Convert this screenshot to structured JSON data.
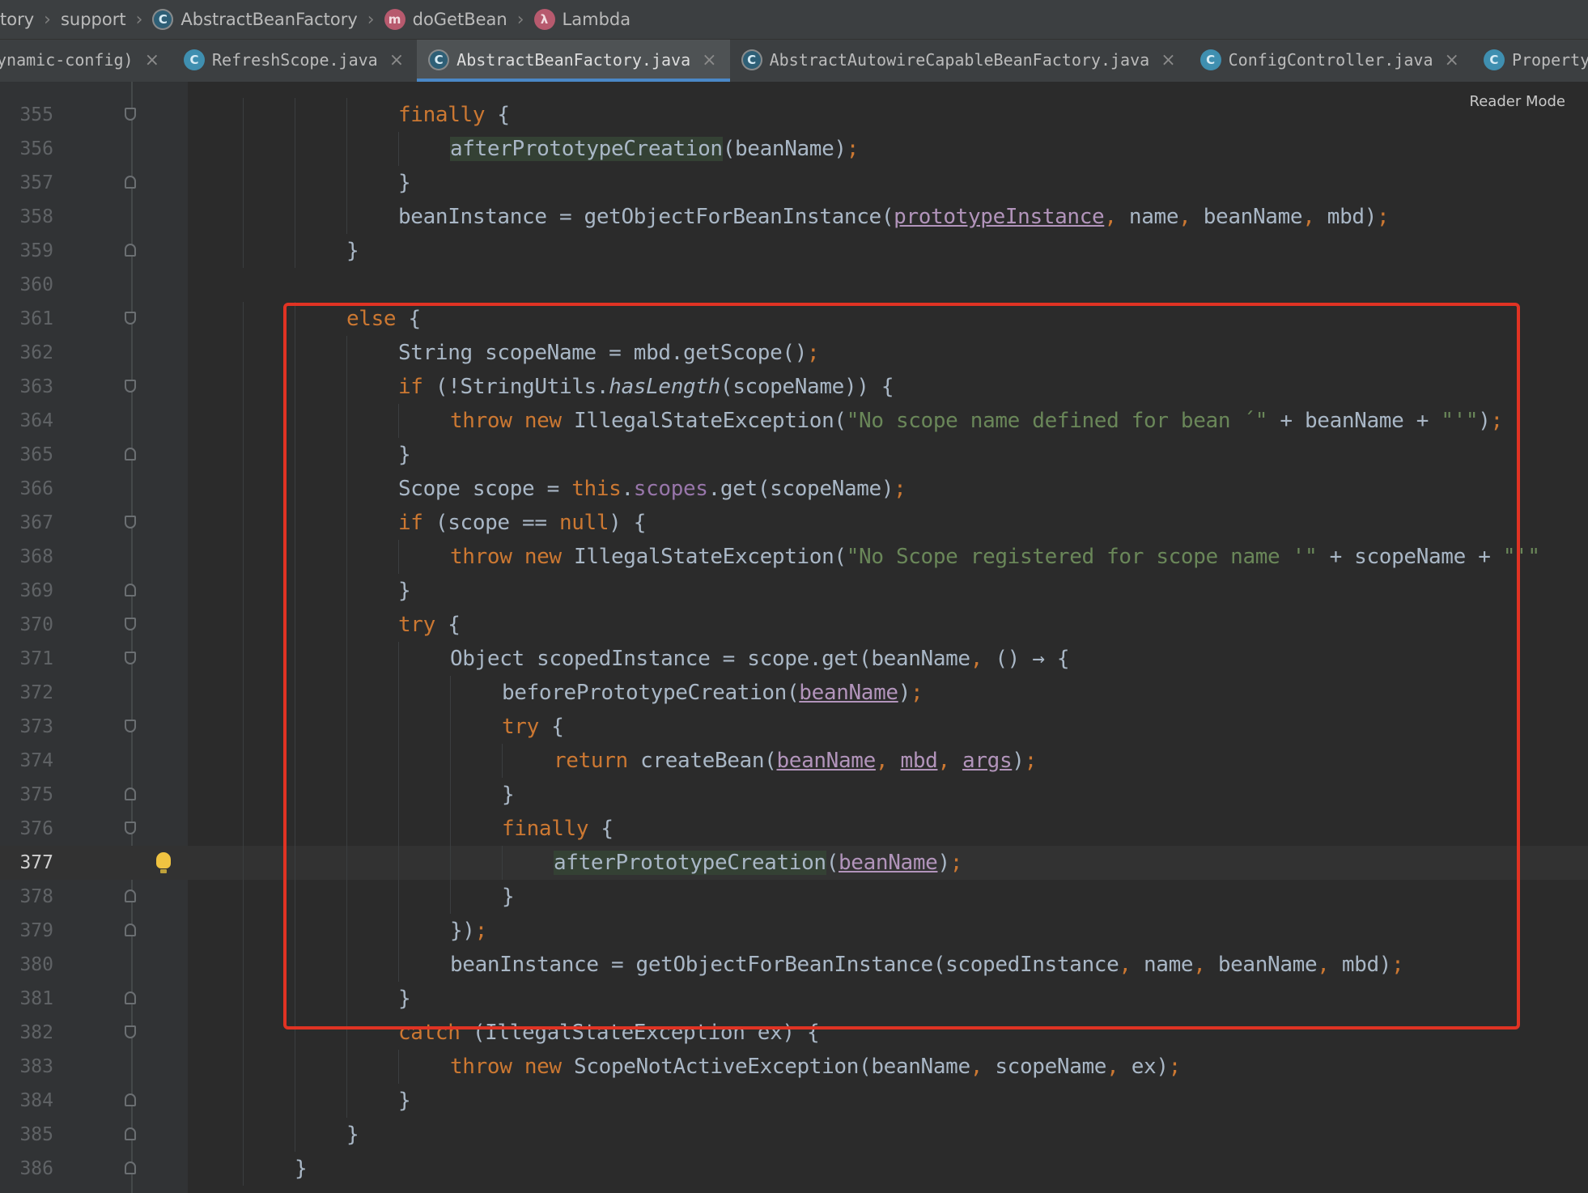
{
  "breadcrumb": {
    "items": [
      "tory",
      "support",
      "AbstractBeanFactory",
      "doGetBean",
      "Lambda"
    ]
  },
  "tabs": [
    {
      "label": "ynamic-config)",
      "active": false,
      "icon": "none"
    },
    {
      "label": "RefreshScope.java",
      "active": false,
      "icon": "class-icon"
    },
    {
      "label": "AbstractBeanFactory.java",
      "active": true,
      "icon": "abstract-class-icon"
    },
    {
      "label": "AbstractAutowireCapableBeanFactory.java",
      "active": false,
      "icon": "abstract-class-icon"
    },
    {
      "label": "ConfigController.java",
      "active": false,
      "icon": "class-icon"
    },
    {
      "label": "PropertySetting.j",
      "active": false,
      "icon": "class-icon"
    }
  ],
  "editor": {
    "reader_mode": "Reader Mode",
    "current_line": 377,
    "lines": [
      {
        "n": "355",
        "fold": "open",
        "indent": 4,
        "parts": [
          [
            "kw",
            "finally"
          ],
          [
            "p",
            " {"
          ]
        ]
      },
      {
        "n": "356",
        "fold": "",
        "indent": 5,
        "parts": [
          [
            "hl",
            "afterPrototypeCreation"
          ],
          [
            "p",
            "(beanName)"
          ],
          [
            "punc",
            ";"
          ]
        ]
      },
      {
        "n": "357",
        "fold": "close",
        "indent": 4,
        "parts": [
          [
            "p",
            "}"
          ]
        ]
      },
      {
        "n": "358",
        "fold": "",
        "indent": 4,
        "parts": [
          [
            "p",
            "beanInstance = getObjectForBeanInstance("
          ],
          [
            "und0",
            "prototypeInstance"
          ],
          [
            "punc",
            ", "
          ],
          [
            "p",
            "name"
          ],
          [
            "punc",
            ", "
          ],
          [
            "p",
            "beanName"
          ],
          [
            "punc",
            ", "
          ],
          [
            "p",
            "mbd)"
          ],
          [
            "punc",
            ";"
          ]
        ]
      },
      {
        "n": "359",
        "fold": "close",
        "indent": 3,
        "parts": [
          [
            "p",
            "}"
          ]
        ]
      },
      {
        "n": "360",
        "fold": "",
        "indent": 0,
        "parts": []
      },
      {
        "n": "361",
        "fold": "open",
        "indent": 3,
        "parts": [
          [
            "kw",
            "else"
          ],
          [
            "p",
            " {"
          ]
        ]
      },
      {
        "n": "362",
        "fold": "",
        "indent": 4,
        "parts": [
          [
            "p",
            "String scopeName = mbd.getScope()"
          ],
          [
            "punc",
            ";"
          ]
        ]
      },
      {
        "n": "363",
        "fold": "open",
        "indent": 4,
        "parts": [
          [
            "kw",
            "if"
          ],
          [
            "p",
            " (!StringUtils."
          ],
          [
            "ital",
            "hasLength"
          ],
          [
            "p",
            "(scopeName)) {"
          ]
        ]
      },
      {
        "n": "364",
        "fold": "",
        "indent": 5,
        "parts": [
          [
            "kw",
            "throw new "
          ],
          [
            "p",
            "IllegalStateException("
          ],
          [
            "str",
            "\"No scope name defined for bean ´\""
          ],
          [
            "p",
            " + beanName + "
          ],
          [
            "str",
            "\"'\""
          ],
          [
            "p",
            ")"
          ],
          [
            "punc",
            ";"
          ]
        ]
      },
      {
        "n": "365",
        "fold": "close",
        "indent": 4,
        "parts": [
          [
            "p",
            "}"
          ]
        ]
      },
      {
        "n": "366",
        "fold": "",
        "indent": 4,
        "parts": [
          [
            "p",
            "Scope scope = "
          ],
          [
            "kw",
            "this"
          ],
          [
            "p",
            "."
          ],
          [
            "fld",
            "scopes"
          ],
          [
            "p",
            ".get(scopeName)"
          ],
          [
            "punc",
            ";"
          ]
        ]
      },
      {
        "n": "367",
        "fold": "open",
        "indent": 4,
        "parts": [
          [
            "kw",
            "if"
          ],
          [
            "p",
            " (scope == "
          ],
          [
            "kw",
            "null"
          ],
          [
            "p",
            ") {"
          ]
        ]
      },
      {
        "n": "368",
        "fold": "",
        "indent": 5,
        "parts": [
          [
            "kw",
            "throw new "
          ],
          [
            "p",
            "IllegalStateException("
          ],
          [
            "str",
            "\"No Scope registered for scope name '\""
          ],
          [
            "p",
            " + scopeName + "
          ],
          [
            "str",
            "\"'\""
          ]
        ]
      },
      {
        "n": "369",
        "fold": "close",
        "indent": 4,
        "parts": [
          [
            "p",
            "}"
          ]
        ]
      },
      {
        "n": "370",
        "fold": "open",
        "indent": 4,
        "parts": [
          [
            "kw",
            "try"
          ],
          [
            "p",
            " {"
          ]
        ]
      },
      {
        "n": "371",
        "fold": "open",
        "indent": 5,
        "parts": [
          [
            "p",
            "Object scopedInstance = scope.get(beanName"
          ],
          [
            "punc",
            ", "
          ],
          [
            "p",
            "() → {"
          ]
        ]
      },
      {
        "n": "372",
        "fold": "",
        "indent": 6,
        "parts": [
          [
            "p",
            "beforePrototypeCreation("
          ],
          [
            "und",
            "beanName"
          ],
          [
            "p",
            ")"
          ],
          [
            "punc",
            ";"
          ]
        ]
      },
      {
        "n": "373",
        "fold": "open",
        "indent": 6,
        "parts": [
          [
            "kw",
            "try"
          ],
          [
            "p",
            " {"
          ]
        ]
      },
      {
        "n": "374",
        "fold": "",
        "indent": 7,
        "parts": [
          [
            "kw",
            "return "
          ],
          [
            "p",
            "createBean("
          ],
          [
            "und",
            "beanName"
          ],
          [
            "punc",
            ", "
          ],
          [
            "und",
            "mbd"
          ],
          [
            "punc",
            ", "
          ],
          [
            "und",
            "args"
          ],
          [
            "p",
            ")"
          ],
          [
            "punc",
            ";"
          ]
        ]
      },
      {
        "n": "375",
        "fold": "close",
        "indent": 6,
        "parts": [
          [
            "p",
            "}"
          ]
        ]
      },
      {
        "n": "376",
        "fold": "open",
        "indent": 6,
        "parts": [
          [
            "kw",
            "finally"
          ],
          [
            "p",
            " {"
          ]
        ]
      },
      {
        "n": "377",
        "fold": "",
        "indent": 7,
        "parts": [
          [
            "hl",
            "afterPrototypeCreation"
          ],
          [
            "p",
            "("
          ],
          [
            "und",
            "beanName"
          ],
          [
            "p",
            ")"
          ],
          [
            "punc",
            ";"
          ]
        ]
      },
      {
        "n": "378",
        "fold": "close",
        "indent": 6,
        "parts": [
          [
            "p",
            "}"
          ]
        ]
      },
      {
        "n": "379",
        "fold": "close",
        "indent": 5,
        "parts": [
          [
            "p",
            "})"
          ],
          [
            "punc",
            ";"
          ]
        ]
      },
      {
        "n": "380",
        "fold": "",
        "indent": 5,
        "parts": [
          [
            "p",
            "beanInstance = getObjectForBeanInstance(scopedInstance"
          ],
          [
            "punc",
            ", "
          ],
          [
            "p",
            "name"
          ],
          [
            "punc",
            ", "
          ],
          [
            "p",
            "beanName"
          ],
          [
            "punc",
            ", "
          ],
          [
            "p",
            "mbd)"
          ],
          [
            "punc",
            ";"
          ]
        ]
      },
      {
        "n": "381",
        "fold": "close",
        "indent": 4,
        "parts": [
          [
            "p",
            "}"
          ]
        ]
      },
      {
        "n": "382",
        "fold": "open",
        "indent": 4,
        "parts": [
          [
            "kw",
            "catch"
          ],
          [
            "p",
            " (IllegalStateException ex) {"
          ]
        ]
      },
      {
        "n": "383",
        "fold": "",
        "indent": 5,
        "parts": [
          [
            "kw",
            "throw new "
          ],
          [
            "p",
            "ScopeNotActiveException(beanName"
          ],
          [
            "punc",
            ", "
          ],
          [
            "p",
            "scopeName"
          ],
          [
            "punc",
            ", "
          ],
          [
            "p",
            "ex)"
          ],
          [
            "punc",
            ";"
          ]
        ]
      },
      {
        "n": "384",
        "fold": "close",
        "indent": 4,
        "parts": [
          [
            "p",
            "}"
          ]
        ]
      },
      {
        "n": "385",
        "fold": "close",
        "indent": 3,
        "parts": [
          [
            "p",
            "}"
          ]
        ]
      },
      {
        "n": "386",
        "fold": "close",
        "indent": 2,
        "parts": [
          [
            "p",
            "}"
          ]
        ]
      }
    ]
  },
  "colors": {
    "keyword": "#cc7832",
    "string": "#6a8759",
    "field": "#9876aa",
    "highlight_box": "#e03323",
    "active_tab_underline": "#4a88c7"
  }
}
